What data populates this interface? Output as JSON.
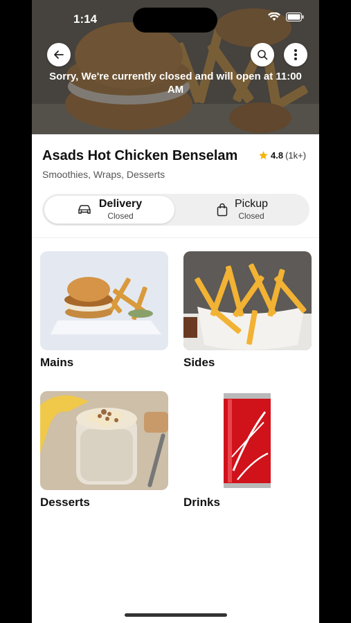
{
  "status_bar": {
    "time": "1:14"
  },
  "hero": {
    "closed_message": "Sorry, We're currently closed and will open at 11:00 AM"
  },
  "restaurant": {
    "name": "Asads Hot Chicken Benselam",
    "rating": "4.8",
    "rating_count": "(1k+)",
    "cuisines": "Smoothies, Wraps, Desserts"
  },
  "fulfillment": {
    "delivery": {
      "label": "Delivery",
      "status": "Closed"
    },
    "pickup": {
      "label": "Pickup",
      "status": "Closed"
    }
  },
  "categories": [
    {
      "label": "Mains"
    },
    {
      "label": "Sides"
    },
    {
      "label": "Desserts"
    },
    {
      "label": "Drinks"
    }
  ],
  "colors": {
    "star": "#f5b400",
    "toggle_bg": "#efefef",
    "coke_red": "#d0121b"
  },
  "icons": [
    "back-arrow-icon",
    "search-icon",
    "more-vertical-icon",
    "star-icon",
    "car-icon",
    "shopping-bag-icon",
    "wifi-icon",
    "battery-icon",
    "signal-icon"
  ]
}
